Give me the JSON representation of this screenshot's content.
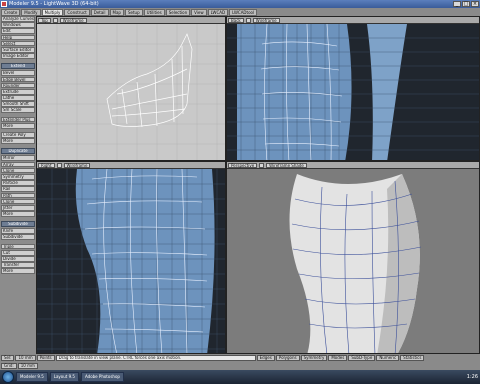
{
  "window": {
    "title": "Modeler 9.5 - LightWave 3D (64-bit)",
    "controls": [
      "_",
      "□",
      "×"
    ]
  },
  "tabs": [
    "Create",
    "Modify",
    "Multiply",
    "Construct",
    "Detail",
    "Map",
    "Setup",
    "Utilities",
    "Selection",
    "View",
    "LWCAD",
    "LWCADtool"
  ],
  "active_tab": "Multiply",
  "tool_panel": {
    "items": [
      {
        "type": "btn",
        "label": "Analyze Curves"
      },
      {
        "type": "btn",
        "label": "Windows"
      },
      {
        "type": "btn",
        "label": "Edit"
      },
      {
        "type": "btn",
        "label": "Help"
      },
      {
        "type": "btn",
        "label": "Select"
      },
      {
        "type": "btn",
        "label": "Surface Editor"
      },
      {
        "type": "btn",
        "label": "Image Editor"
      },
      {
        "type": "gap"
      },
      {
        "type": "head",
        "label": "Extend"
      },
      {
        "type": "btn",
        "label": "Bevel"
      },
      {
        "type": "btn",
        "label": "Edge Bevel"
      },
      {
        "type": "btn",
        "label": "Rounder"
      },
      {
        "type": "btn",
        "label": "Extrude"
      },
      {
        "type": "btn",
        "label": "Lathe"
      },
      {
        "type": "btn",
        "label": "Smooth Shift"
      },
      {
        "type": "btn",
        "label": "Sm Scale"
      },
      {
        "type": "gap"
      },
      {
        "type": "btn",
        "label": "Extender Plus"
      },
      {
        "type": "btn",
        "label": "More"
      },
      {
        "type": "gap"
      },
      {
        "type": "btn",
        "label": "Create Poly"
      },
      {
        "type": "btn",
        "label": "More"
      },
      {
        "type": "gap"
      },
      {
        "type": "head",
        "label": "Duplicate"
      },
      {
        "type": "btn",
        "label": "Mirror"
      },
      {
        "type": "btn",
        "label": "Array"
      },
      {
        "type": "btn",
        "label": "Clone"
      },
      {
        "type": "btn",
        "label": "Symmetry"
      },
      {
        "type": "btn",
        "label": "Particle"
      },
      {
        "type": "btn",
        "label": "Rail"
      },
      {
        "type": "btn",
        "label": "Path"
      },
      {
        "type": "btn",
        "label": "Clone"
      },
      {
        "type": "btn",
        "label": "Jitter"
      },
      {
        "type": "btn",
        "label": "More"
      },
      {
        "type": "gap"
      },
      {
        "type": "head",
        "label": "Subdivide"
      },
      {
        "type": "btn",
        "label": "Knife"
      },
      {
        "type": "btn",
        "label": "Subdivide"
      },
      {
        "type": "gap"
      },
      {
        "type": "btn",
        "label": "Triple"
      },
      {
        "type": "btn",
        "label": "Cut"
      },
      {
        "type": "btn",
        "label": "Divide"
      },
      {
        "type": "btn",
        "label": "Transfer"
      },
      {
        "type": "btn",
        "label": "More"
      }
    ]
  },
  "viewports": {
    "top": {
      "view": "Top",
      "mode": "Wireframe"
    },
    "back": {
      "view": "Back",
      "mode": "Wireframe"
    },
    "right": {
      "view": "Right",
      "mode": "Wireframe"
    },
    "persp": {
      "view": "Perspective",
      "mode": "Wireframe Shade"
    }
  },
  "bottom_bar": {
    "buttons": [
      "Sel:",
      "10 mm",
      "Points",
      "Edges",
      "Polygons",
      "Symmetry",
      "Modes",
      "SubD-Type",
      "Numeric",
      "Statistics"
    ],
    "message": "Drag to translate in view plane. CTRL forces one axis motion."
  },
  "status_row": [
    "Grid:",
    "10 mm"
  ],
  "taskbar": {
    "tasks": [
      "Modeler 9.5",
      "Layout 9.5",
      "Adobe Photoshop"
    ],
    "clock": "1:26"
  }
}
